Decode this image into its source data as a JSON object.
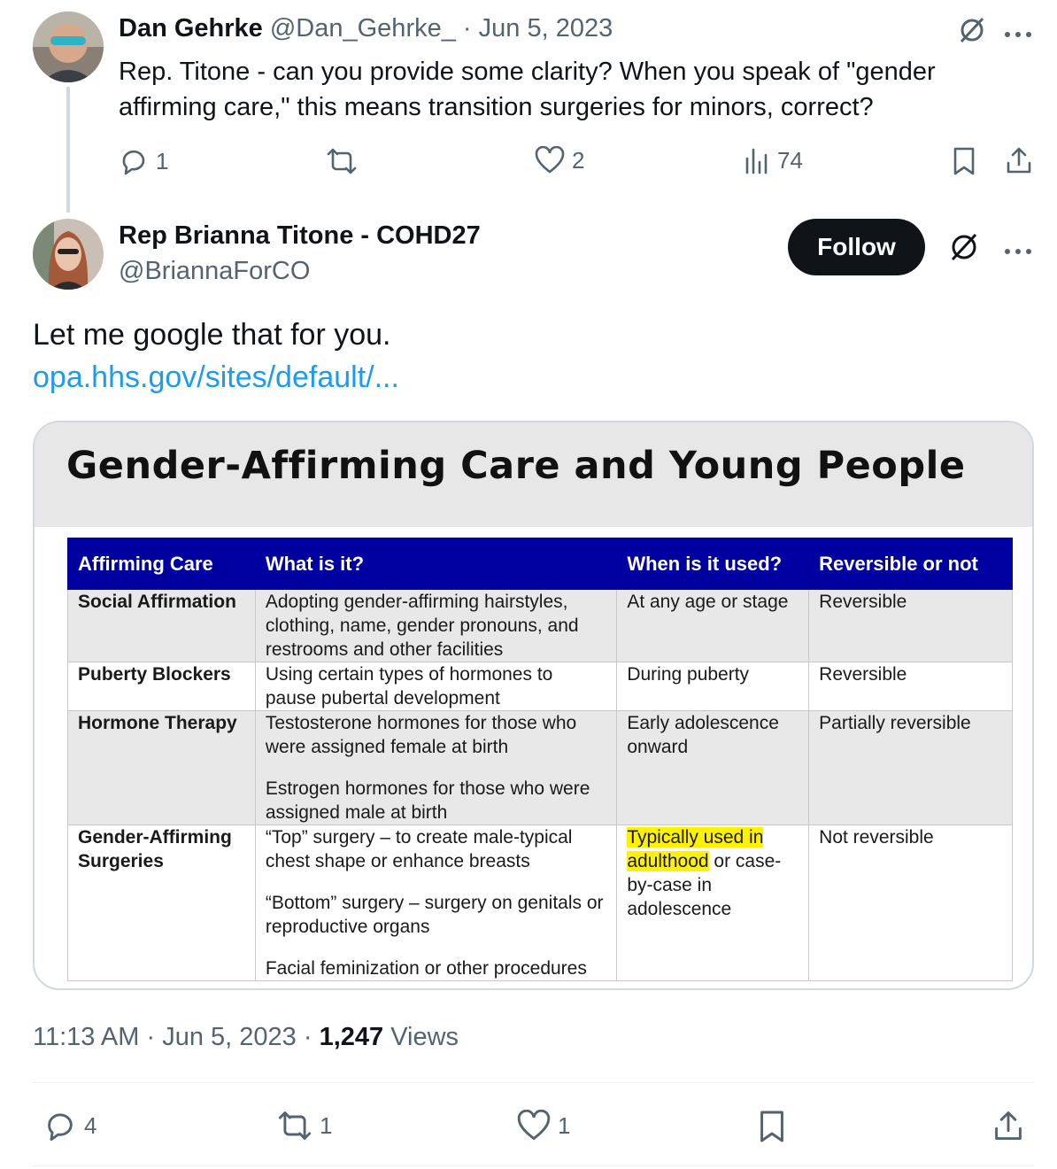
{
  "reply_tweet": {
    "author_name": "Dan Gehrke",
    "handle": "@Dan_Gehrke_",
    "separator": "·",
    "date": "Jun 5, 2023",
    "text_line1": "Rep. Titone - can you provide some clarity? When you speak of \"gender",
    "text_line2": "affirming care,\" this means transition surgeries for minors, correct?",
    "replies": "1",
    "reposts": "",
    "likes": "2",
    "views": "74"
  },
  "main_tweet": {
    "author_name": "Rep Brianna Titone - COHD27",
    "handle": "@BriannaForCO",
    "follow_label": "Follow",
    "text": "Let me google that for you.",
    "link": "opa.hhs.gov/sites/default/...",
    "time": "11:13 AM",
    "separator": "·",
    "date": "Jun 5, 2023",
    "views_count": "1,247",
    "views_label": "Views",
    "replies": "4",
    "reposts": "1",
    "likes": "1"
  },
  "image_card": {
    "title": "Gender-Affirming Care and Young People",
    "table": {
      "headers": [
        "Affirming Care",
        "What is it?",
        "When is it used?",
        "Reversible or not"
      ],
      "rows": [
        {
          "name": "Social Affirmation",
          "what": "Adopting gender-affirming hairstyles, clothing, name, gender pronouns, and restrooms and other facilities",
          "when": "At any age or stage",
          "reversible": "Reversible"
        },
        {
          "name": "Puberty Blockers",
          "what": "Using certain types of hormones to pause pubertal development",
          "when": "During puberty",
          "reversible": "Reversible"
        },
        {
          "name": "Hormone Therapy",
          "what_1": "Testosterone hormones for those who were assigned female at birth",
          "what_2": "Estrogen hormones for those who were assigned male at birth",
          "when": "Early adolescence onward",
          "reversible": "Partially reversible"
        },
        {
          "name": "Gender-Affirming Surgeries",
          "what_1": "“Top” surgery – to create male-typical chest shape or enhance breasts",
          "what_2": "“Bottom” surgery – surgery on genitals or reproductive organs",
          "what_3": "Facial feminization or other procedures",
          "when_highlight": "Typically used in adulthood",
          "when_rest": "or case-by-case in adolescence",
          "reversible": "Not reversible"
        }
      ]
    }
  },
  "colors": {
    "accent": "#1d9bf0",
    "header_blue": "#0000a0",
    "highlight": "#fff200",
    "follow_bg": "#0f1419"
  }
}
